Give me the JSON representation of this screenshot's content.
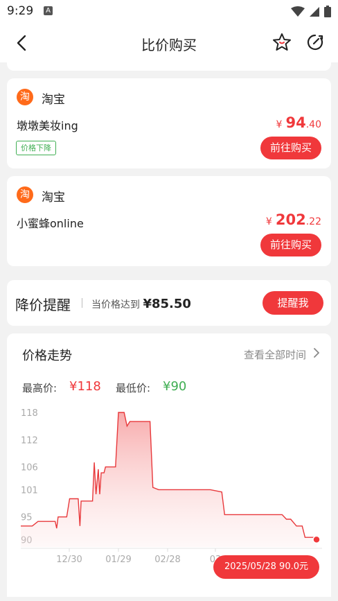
{
  "status_bar": {
    "time": "9:29",
    "notification_glyph": "A"
  },
  "nav": {
    "title": "比价购买"
  },
  "offers": [
    {
      "shop": "淘宝",
      "shop_logo_char": "淘",
      "seller": "墩墩美妆ing",
      "price_symbol": "¥",
      "price_int": "94",
      "price_dec": ".40",
      "badge": "价格下降",
      "button": "前往购买"
    },
    {
      "shop": "淘宝",
      "shop_logo_char": "淘",
      "seller": "小蜜蜂online",
      "price_symbol": "¥",
      "price_int": "202",
      "price_dec": ".22",
      "button": "前往购买"
    }
  ],
  "alert": {
    "title": "降价提醒",
    "text": "当价格达到",
    "price": "¥85.50",
    "button": "提醒我"
  },
  "trend": {
    "title": "价格走势",
    "view_all": "查看全部时间",
    "high_label": "最高价:",
    "high_value": "¥118",
    "low_label": "最低价:",
    "low_value": "¥90",
    "tooltip": "2025/05/28 90.0元"
  },
  "colors": {
    "accent": "#f0383b",
    "green": "#3fae52",
    "shop_orange": "#ff6a1a"
  },
  "chart_data": {
    "type": "area",
    "y_ticks": [
      118,
      112,
      106,
      101,
      95,
      90
    ],
    "ylim": [
      89,
      118
    ],
    "x_ticks": [
      "12/30",
      "01/29",
      "02/28",
      "03"
    ],
    "series": [
      {
        "values": [
          [
            0,
            93
          ],
          [
            4,
            93
          ],
          [
            6,
            94
          ],
          [
            12,
            94
          ],
          [
            12.5,
            92.5
          ],
          [
            13,
            95
          ],
          [
            16,
            95
          ],
          [
            17,
            99
          ],
          [
            20,
            99
          ],
          [
            20.6,
            93
          ],
          [
            21,
            98.5
          ],
          [
            25,
            98.5
          ],
          [
            25.6,
            107
          ],
          [
            26.2,
            100
          ],
          [
            27,
            105.5
          ],
          [
            27.5,
            100
          ],
          [
            28,
            104.7
          ],
          [
            29,
            104.7
          ],
          [
            29.5,
            106
          ],
          [
            33,
            106
          ],
          [
            34,
            118
          ],
          [
            36,
            118
          ],
          [
            37,
            115
          ],
          [
            38,
            116
          ],
          [
            45,
            116
          ],
          [
            46,
            101.5
          ],
          [
            48,
            101
          ],
          [
            66,
            101
          ],
          [
            70,
            100.5
          ],
          [
            71,
            95.5
          ],
          [
            77,
            95.5
          ],
          [
            85,
            95.5
          ],
          [
            91,
            95.5
          ],
          [
            92.5,
            94.5
          ],
          [
            94,
            94.5
          ],
          [
            96,
            93
          ],
          [
            98,
            93
          ],
          [
            99,
            90.5
          ],
          [
            102,
            90.5
          ],
          [
            103,
            90
          ]
        ]
      }
    ]
  }
}
